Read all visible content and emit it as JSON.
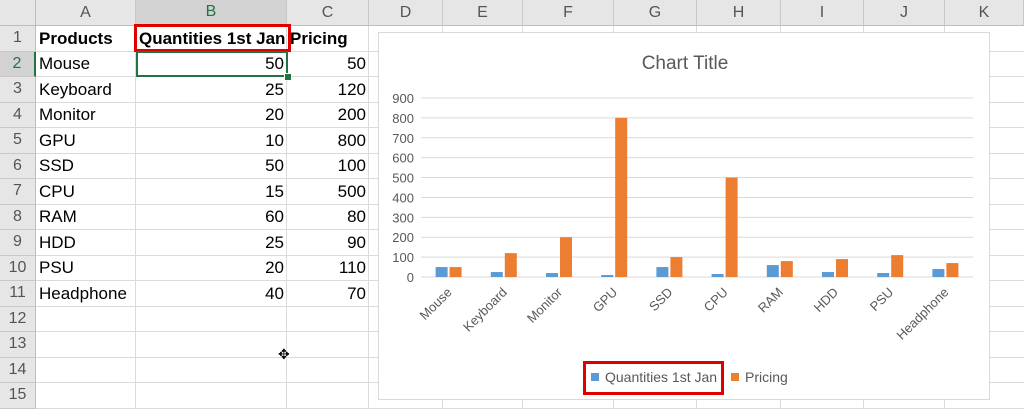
{
  "spreadsheet": {
    "columns": [
      "A",
      "B",
      "C",
      "D",
      "E",
      "F",
      "G",
      "H",
      "I",
      "J",
      "K"
    ],
    "rows": [
      "1",
      "2",
      "3",
      "4",
      "5",
      "6",
      "7",
      "8",
      "9",
      "10",
      "11",
      "12",
      "13",
      "14",
      "15"
    ],
    "selected_column": "B",
    "selected_row": "2",
    "headers": {
      "a": "Products",
      "b": "Quantities 1st Jan",
      "c": "Pricing"
    },
    "data_rows": [
      {
        "product": "Mouse",
        "quantity": "50",
        "pricing": "50"
      },
      {
        "product": "Keyboard",
        "quantity": "25",
        "pricing": "120"
      },
      {
        "product": "Monitor",
        "quantity": "20",
        "pricing": "200"
      },
      {
        "product": "GPU",
        "quantity": "10",
        "pricing": "800"
      },
      {
        "product": "SSD",
        "quantity": "50",
        "pricing": "100"
      },
      {
        "product": "CPU",
        "quantity": "15",
        "pricing": "500"
      },
      {
        "product": "RAM",
        "quantity": "60",
        "pricing": "80"
      },
      {
        "product": "HDD",
        "quantity": "25",
        "pricing": "90"
      },
      {
        "product": "PSU",
        "quantity": "20",
        "pricing": "110"
      },
      {
        "product": "Headphone",
        "quantity": "40",
        "pricing": "70"
      }
    ]
  },
  "colors": {
    "series_quantities": "#5b9bd5",
    "series_pricing": "#ed7d31",
    "highlight": "#e00000",
    "selection": "#217346"
  },
  "chart_data": {
    "type": "bar",
    "title": "Chart Title",
    "categories": [
      "Mouse",
      "Keyboard",
      "Monitor",
      "GPU",
      "SSD",
      "CPU",
      "RAM",
      "HDD",
      "PSU",
      "Headphone"
    ],
    "series": [
      {
        "name": "Quantities 1st Jan",
        "values": [
          50,
          25,
          20,
          10,
          50,
          15,
          60,
          25,
          20,
          40
        ]
      },
      {
        "name": "Pricing",
        "values": [
          50,
          120,
          200,
          800,
          100,
          500,
          80,
          90,
          110,
          70
        ]
      }
    ],
    "ylim": [
      0,
      900
    ],
    "yticks": [
      "0",
      "100",
      "200",
      "300",
      "400",
      "500",
      "600",
      "700",
      "800",
      "900"
    ],
    "grid": true,
    "legend": "bottom"
  }
}
